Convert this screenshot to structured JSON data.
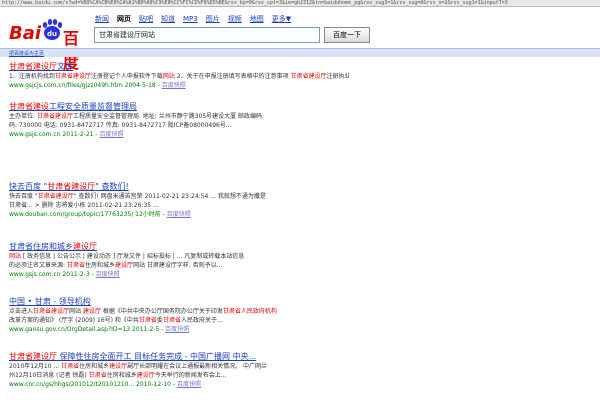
{
  "browser": {
    "address": "http://www.baidu.com/s?wd=%B8%CA%CB%E0%CA%A1%BD%A8%C9%E8%CC%FC%CD%F8%D5%BE&rsv_bp=0&rsv_spt=3&ie=gb2312&tn=baiduhome_pg&rsv_sug3=1&rsv_sug=0&rsv_n=2&rsv_sug1=1&inputT=3"
  },
  "logo": {
    "bai": "Bai",
    "du_txt": "百度"
  },
  "nav": {
    "items": [
      "新闻",
      "网页",
      "贴吧",
      "知道",
      "MP3",
      "图片",
      "视频",
      "地图",
      "更多▼"
    ],
    "active_index": 1
  },
  "search": {
    "query": "甘肃省建设厅网站",
    "button": "百度一下"
  },
  "topbar": {
    "link": "把百度设为主页"
  },
  "results": [
    {
      "title": [
        [
          "甘肃省建设厅",
          true
        ],
        [
          "文件",
          false
        ]
      ],
      "desc": [
        [
          [
            "1、注册机构找到",
            false
          ],
          [
            "甘肃省建设厅",
            true
          ],
          [
            "注册登记个人申报软件下载",
            false
          ],
          [
            "网站",
            true
          ],
          [
            " 2、关于在申报注册填写表格中的注意事项 ",
            false
          ],
          [
            "甘肃省建设厅",
            true
          ],
          [
            "注册执业资格领导小组  二00四年四月二十日...",
            false
          ]
        ]
      ],
      "url": "www.gsjcjs.com.cn/files/gjzz049h.htm 2004-5-18",
      "cache": "百度快照"
    },
    {
      "title": [
        [
          "甘肃省建设",
          true
        ],
        [
          "工程安全质量监督管理局",
          false
        ]
      ],
      "desc": [
        [
          [
            "主办单位: ",
            false
          ],
          [
            "甘肃省建设厅",
            true
          ],
          [
            "工程质量安全监督管理局.  地址: 兰州市静宁路305号建设大厦  邮政编码:",
            false
          ]
        ],
        [
          [
            "码: 730000 电话: 0931-8472717 传真: 0931-8472717 陇ICP备08000496号...",
            false
          ]
        ]
      ],
      "url": "www.gsjs.com.cn 2011-2-21",
      "cache": "百度快照"
    },
    {
      "title": [
        [
          "快去百度 \"",
          false
        ],
        [
          "甘肃省建设厅",
          true
        ],
        [
          "\" 查数们!",
          false
        ]
      ],
      "desc": [
        [
          [
            "快去百度 \"",
            false
          ],
          [
            "甘肃省建设厅",
            true
          ],
          [
            "\" 查数们!  网盘米通苦宫荣  2011-02-21 23:24:54 ...  我就想不通为撒是",
            false
          ]
        ],
        [
          [
            "甘肃省...  > 删除  志将爱小栋  2011-02-21 23:26:35 ...",
            false
          ]
        ]
      ],
      "url": "www.douban.com/group/topic/17763235/ 12小时前",
      "cache": "百度快照"
    },
    {
      "title": [
        [
          "甘肃省住房和城乡",
          false
        ],
        [
          "建设厅",
          true
        ]
      ],
      "desc": [
        [
          [
            "网站",
            true
          ],
          [
            "  [ 政务信息 | 公告公示 | 建设动态 ]  厅发文件 | 招标投标 | ... 凡复制或转载本站信息",
            false
          ]
        ],
        [
          [
            "的必须注名文章来源: ",
            false
          ],
          [
            "甘肃省",
            true
          ],
          [
            "住房和城乡",
            false
          ],
          [
            "建设厅",
            true
          ],
          [
            "网站 甘肃建设厅字样, 否则予以...",
            false
          ]
        ]
      ],
      "url": "www.gsjs.com.cn 2011-2-3",
      "cache": "百度快照"
    },
    {
      "title": [
        [
          "中国 • 甘肃 - 领导机构",
          false
        ]
      ],
      "desc": [
        [
          [
            "点击进入",
            false
          ],
          [
            "甘肃省建设厅",
            true
          ],
          [
            "网站 ",
            false
          ],
          [
            "建设厅",
            true
          ],
          [
            "  根据《中共中央办公厅国务院办公厅关于印发",
            false
          ],
          [
            "甘肃省人民政府机构",
            true
          ]
        ],
        [
          [
            "改革方案的通知》 (厅字 (2009) 16号) 和《中共",
            false
          ],
          [
            "甘肃省",
            true
          ],
          [
            "委",
            false
          ],
          [
            "甘肃省",
            true
          ],
          [
            "人民政府关于...",
            false
          ]
        ]
      ],
      "url": "www.gansu.gov.cn/OrgDetail.asp?ID=13 2011-2-5",
      "cache": "百度快照"
    },
    {
      "title": [
        [
          "甘肃省建设厅",
          true
        ],
        [
          " 保障性住房全面开工  目标任务完成 - 中国广播网 中央...",
          false
        ]
      ],
      "desc": [
        [
          [
            "2010年12月10 ... ",
            false
          ],
          [
            "甘肃省",
            true
          ],
          [
            "住房和城乡",
            false
          ],
          [
            "建设厅",
            true
          ],
          [
            "副厅长邵明耀在会议上通报最新相关情况。  中广网兰",
            false
          ]
        ],
        [
          [
            "州12月10日消息 (记者 徐磊) ",
            false
          ],
          [
            "甘肃省",
            true
          ],
          [
            "住房和城乡",
            false
          ],
          [
            "建设厅",
            true
          ],
          [
            "今天举行的新闻发布会上...",
            false
          ]
        ]
      ],
      "url": "www.cnr.cn/gs/hhgs/201012/t20101210... 2010-12-10",
      "cache": "百度快照"
    }
  ]
}
